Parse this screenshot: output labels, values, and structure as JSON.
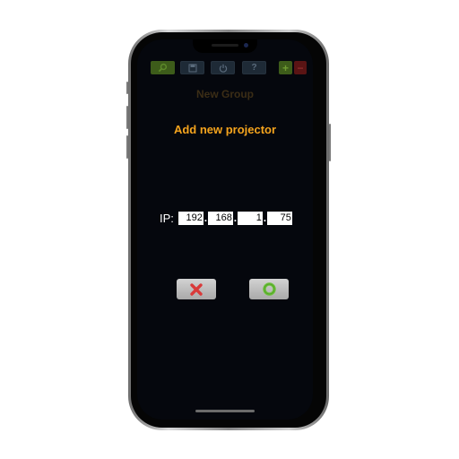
{
  "app": {
    "header_title": "New Group",
    "dialog_title": "Add new projector"
  },
  "toolbar": {
    "icons": [
      "search-icon",
      "save-icon",
      "power-icon",
      "help-icon",
      "add-icon",
      "remove-icon"
    ],
    "help_glyph": "?",
    "add_glyph": "+",
    "remove_glyph": "−"
  },
  "ip": {
    "label": "IP:",
    "octets": [
      "192",
      "168",
      "1",
      "75"
    ],
    "separator": "."
  },
  "actions": {
    "cancel_icon": "x-icon",
    "confirm_icon": "ok-ring-icon"
  },
  "colors": {
    "accent": "#f5a41d",
    "cancel": "#d93a3a",
    "confirm": "#6cc23a"
  }
}
